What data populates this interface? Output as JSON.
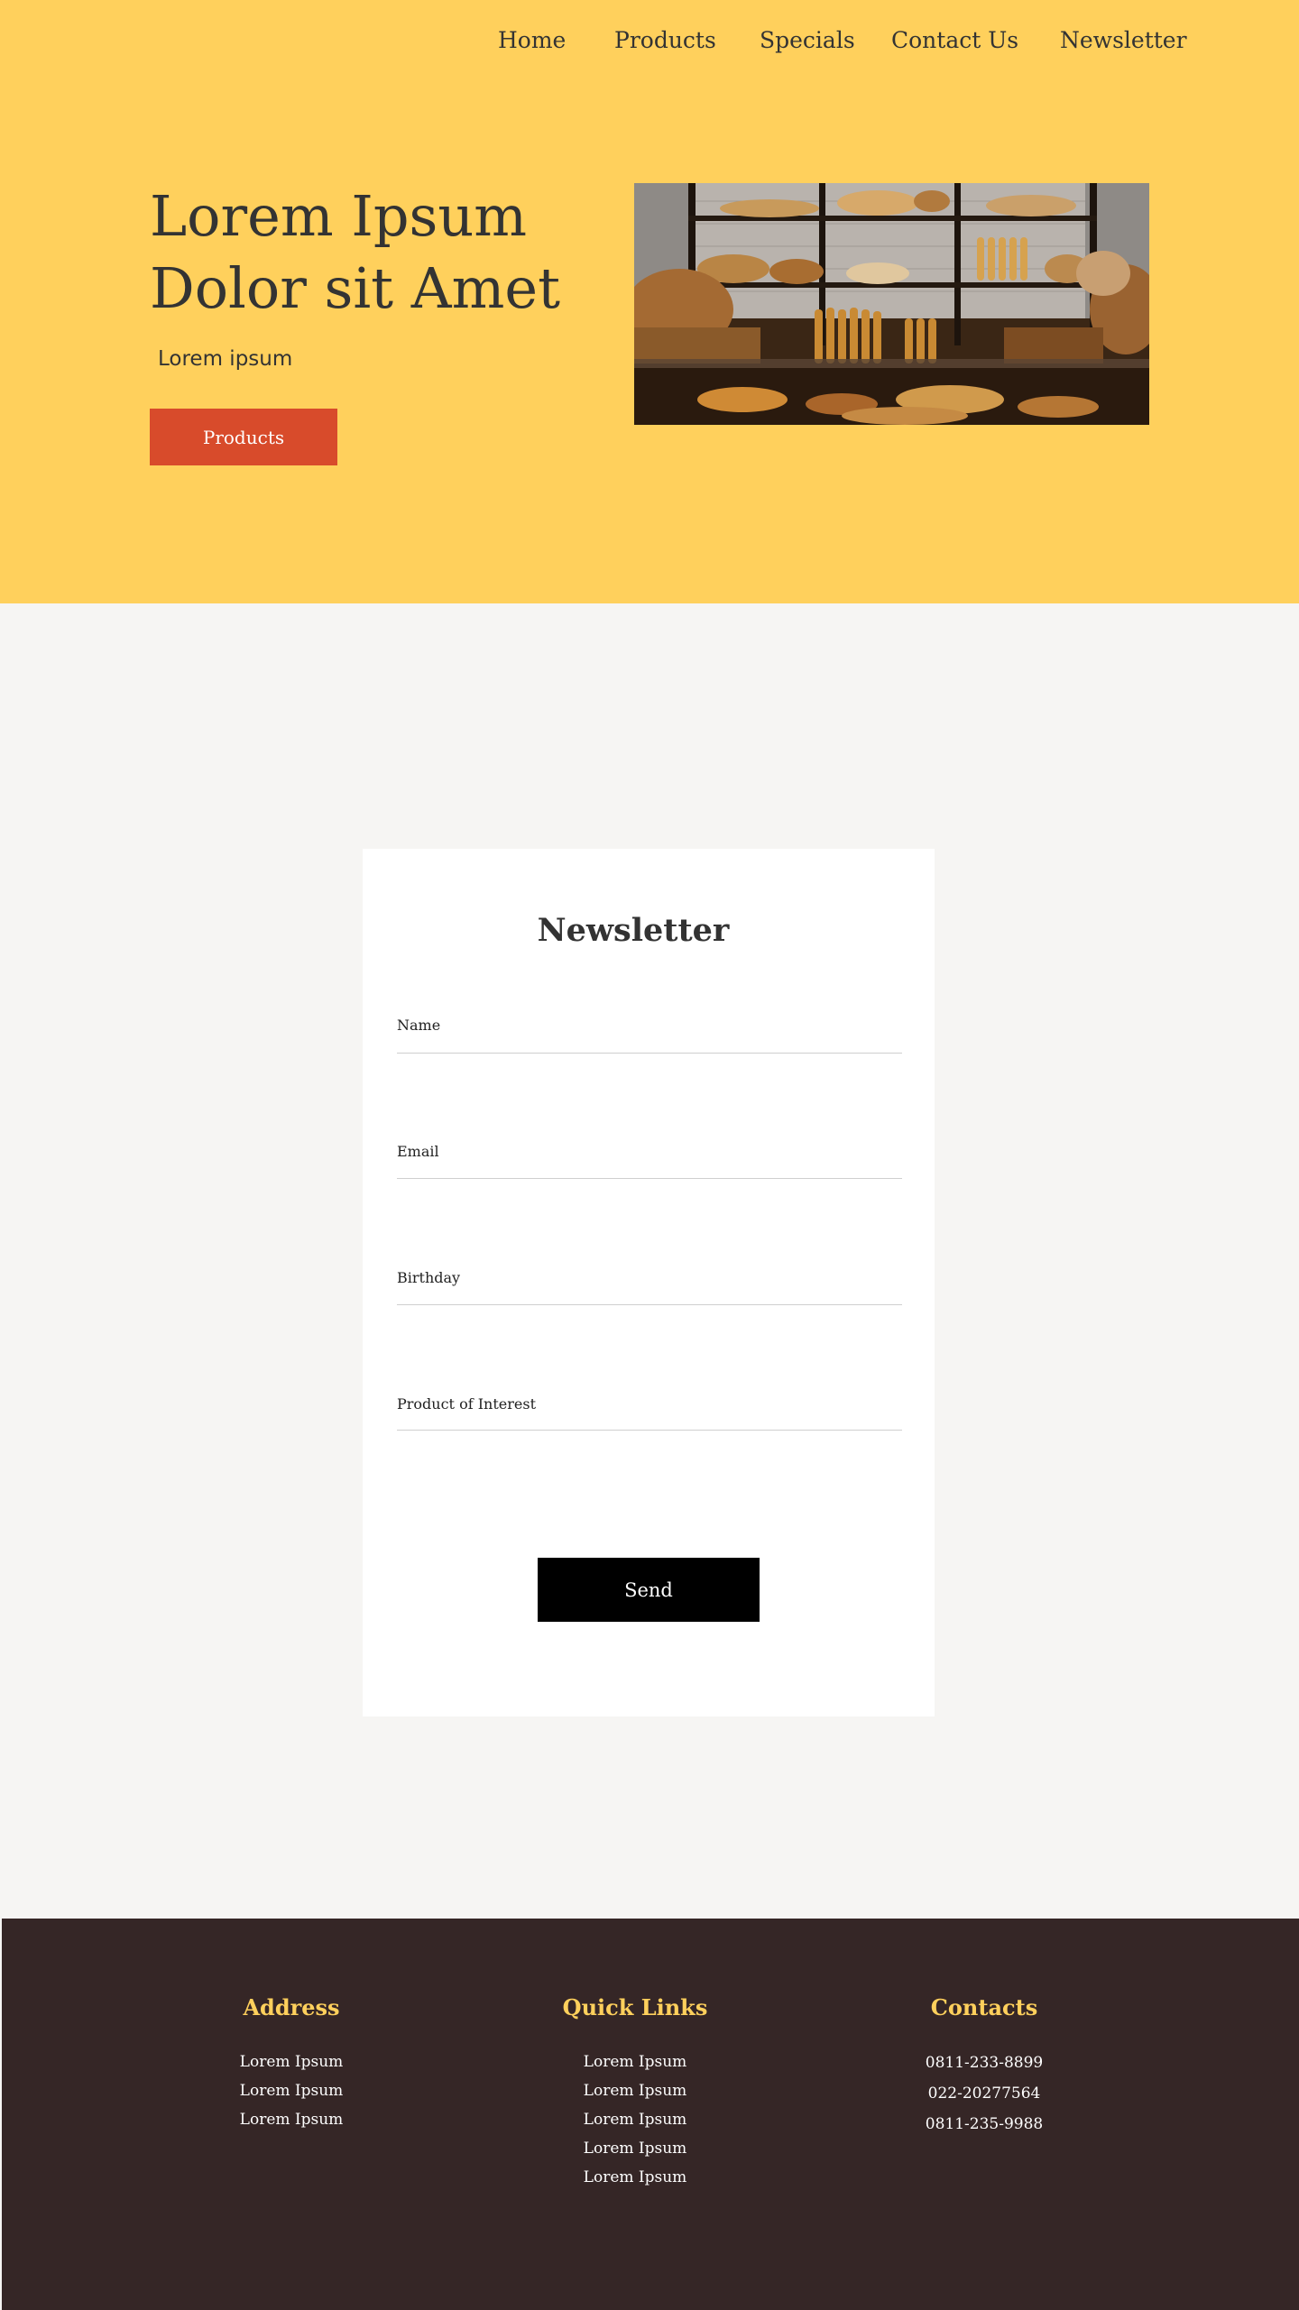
{
  "nav": {
    "items": [
      {
        "label": "Home"
      },
      {
        "label": "Products"
      },
      {
        "label": "Specials"
      },
      {
        "label": "Contact Us"
      },
      {
        "label": "Newsletter"
      }
    ]
  },
  "hero": {
    "title_line1": "Lorem Ipsum",
    "title_line2": "Dolor sit Amet",
    "subtitle": "Lorem ipsum",
    "button_label": "Products"
  },
  "newsletter": {
    "title": "Newsletter",
    "fields": [
      {
        "label": "Name",
        "value": ""
      },
      {
        "label": "Email",
        "value": ""
      },
      {
        "label": "Birthday",
        "value": ""
      },
      {
        "label": "Product of Interest",
        "value": ""
      }
    ],
    "send_label": "Send"
  },
  "footer": {
    "address": {
      "heading": "Address",
      "lines": [
        "Lorem Ipsum",
        "Lorem Ipsum",
        "Lorem Ipsum"
      ]
    },
    "quick_links": {
      "heading": "Quick Links",
      "links": [
        "Lorem Ipsum",
        "Lorem Ipsum",
        "Lorem Ipsum",
        "Lorem Ipsum",
        "Lorem Ipsum"
      ]
    },
    "contacts": {
      "heading": "Contacts",
      "phones": [
        "0811-233-8899",
        "022-20277564",
        "0811-235-9988"
      ]
    }
  },
  "colors": {
    "hero_bg": "#ffd05c",
    "page_bg": "#f6f5f3",
    "accent_button": "#d84b2b",
    "send_button": "#000000",
    "footer_bg": "#352626",
    "footer_heading": "#ffd05c",
    "text_dark": "#333333"
  },
  "images": {
    "hero_image": "bakery-shelves-photo"
  }
}
